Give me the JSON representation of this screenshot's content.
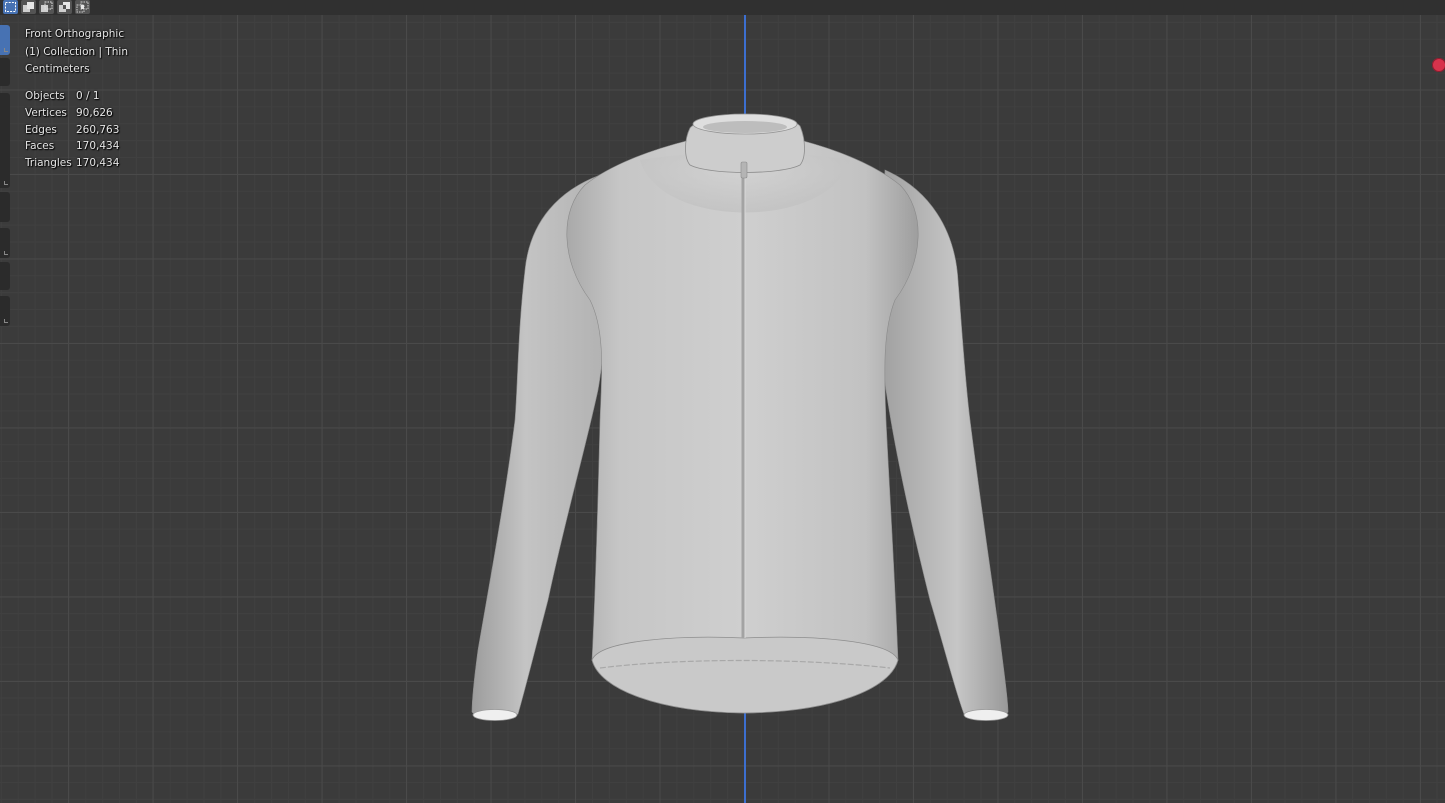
{
  "viewport": {
    "view_name": "Front Orthographic",
    "collection_info": "(1) Collection | Thin",
    "units": "Centimeters",
    "stats": [
      {
        "label": "Objects",
        "value": "0 / 1"
      },
      {
        "label": "Vertices",
        "value": "90,626"
      },
      {
        "label": "Edges",
        "value": "260,763"
      },
      {
        "label": "Faces",
        "value": "170,434"
      },
      {
        "label": "Triangles",
        "value": "170,434"
      }
    ]
  },
  "toolbar": {
    "selection_modes": [
      {
        "icon": "select-new-icon",
        "active": true
      },
      {
        "icon": "select-extend-icon",
        "active": false
      },
      {
        "icon": "select-subtract-icon",
        "active": false
      },
      {
        "icon": "select-difference-icon",
        "active": false
      },
      {
        "icon": "select-intersect-icon",
        "active": false
      }
    ]
  },
  "colors": {
    "background": "#3b3b3b",
    "z_axis": "#3c6fd0",
    "x_axis_gizmo": "#d7334c",
    "accent": "#4772b3",
    "mesh": "#c8c8c8"
  },
  "scene": {
    "object": "long-sleeve-cycling-jersey-mesh"
  }
}
